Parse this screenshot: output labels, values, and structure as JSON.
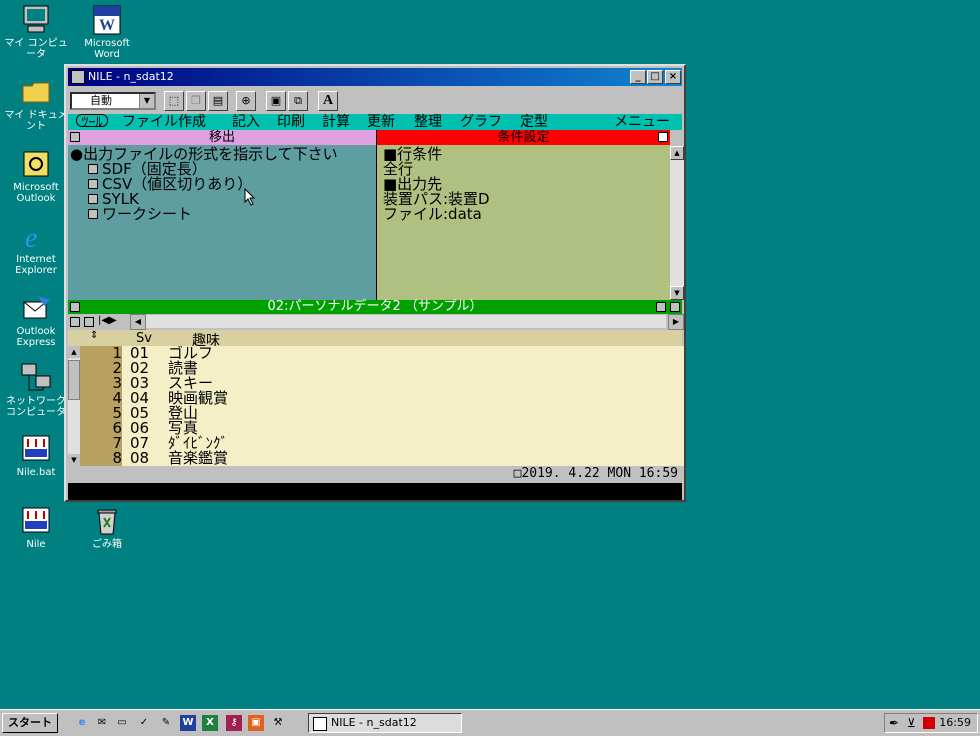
{
  "desktop": {
    "icons": [
      {
        "label": "マイ コンピュータ"
      },
      {
        "label": "Microsoft Word"
      },
      {
        "label": "マイ ドキュメント"
      },
      {
        "label": "Microsoft Outlook"
      },
      {
        "label": "Internet Explorer"
      },
      {
        "label": "Outlook Express"
      },
      {
        "label": "ネットワーク コンピュータ"
      },
      {
        "label": "Nile.bat"
      },
      {
        "label": "Nile"
      },
      {
        "label": "ごみ箱"
      }
    ]
  },
  "window": {
    "title": "NILE - n_sdat12",
    "toolbar": {
      "mode": "自動",
      "font_btn": "A"
    },
    "menu": {
      "tool_tag": "ﾂｰﾙ",
      "items": [
        "ファイル作成",
        "記入",
        "印刷",
        "計算",
        "更新",
        "整理",
        "グラフ",
        "定型",
        "メニュー"
      ]
    },
    "left_pane": {
      "header": "移出",
      "prompt": "●出力ファイルの形式を指示して下さい",
      "options": [
        "SDF（固定長）",
        "CSV（値区切りあり）",
        "SYLK",
        "ワークシート"
      ]
    },
    "right_pane": {
      "header": "条件設定",
      "lines": [
        "■行条件",
        "全行",
        "■出力先",
        "装置パス:装置D",
        "ファイル:data"
      ]
    },
    "mid_title": "02:パーソナルデータ2 （サンプル）",
    "grid": {
      "columns": [
        "Sv",
        "趣味"
      ],
      "rows": [
        {
          "n": "1",
          "sv": "01",
          "hobby": "ゴルフ"
        },
        {
          "n": "2",
          "sv": "02",
          "hobby": "読書"
        },
        {
          "n": "3",
          "sv": "03",
          "hobby": "スキー"
        },
        {
          "n": "4",
          "sv": "04",
          "hobby": "映画観賞"
        },
        {
          "n": "5",
          "sv": "05",
          "hobby": "登山"
        },
        {
          "n": "6",
          "sv": "06",
          "hobby": "写真"
        },
        {
          "n": "7",
          "sv": "07",
          "hobby": "ﾀﾞｲﾋﾞﾝｸﾞ"
        },
        {
          "n": "8",
          "sv": "08",
          "hobby": "音楽鑑賞"
        }
      ]
    },
    "status_clock": "2019. 4.22 MON 16:59"
  },
  "taskbar": {
    "start_label": "スタート",
    "task_label": "NILE - n_sdat12",
    "time": "16:59"
  },
  "colors": {
    "desktop": "#008080",
    "title_bar": "#000080",
    "menu_bar": "#00c0b0"
  }
}
